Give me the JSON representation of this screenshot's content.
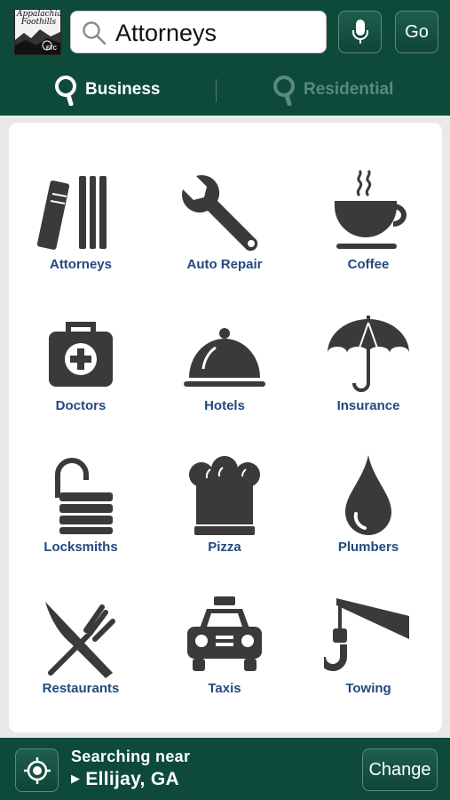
{
  "logo": {
    "line1": "Appalachian",
    "line2": "Foothills",
    "brand": "ETC"
  },
  "search": {
    "value": "Attorneys",
    "placeholder": ""
  },
  "header": {
    "go_label": "Go"
  },
  "tabs": [
    {
      "label": "Business",
      "active": true
    },
    {
      "label": "Residential",
      "active": false
    }
  ],
  "categories": [
    {
      "label": "Attorneys",
      "icon": "books-icon"
    },
    {
      "label": "Auto Repair",
      "icon": "wrench-icon"
    },
    {
      "label": "Coffee",
      "icon": "coffee-cup-icon"
    },
    {
      "label": "Doctors",
      "icon": "medical-bag-icon"
    },
    {
      "label": "Hotels",
      "icon": "cloche-icon"
    },
    {
      "label": "Insurance",
      "icon": "umbrella-icon"
    },
    {
      "label": "Locksmiths",
      "icon": "padlock-icon"
    },
    {
      "label": "Pizza",
      "icon": "chef-hat-icon"
    },
    {
      "label": "Plumbers",
      "icon": "water-drop-icon"
    },
    {
      "label": "Restaurants",
      "icon": "fork-knife-icon"
    },
    {
      "label": "Taxis",
      "icon": "taxi-icon"
    },
    {
      "label": "Towing",
      "icon": "tow-hook-icon"
    }
  ],
  "location": {
    "label": "Searching near",
    "city": "Ellijay, GA",
    "change_label": "Change"
  },
  "colors": {
    "bar": "#0d4a3a",
    "label": "#23497e",
    "icon": "#3a3a3a",
    "inactive_tab": "#5b8a7c"
  }
}
